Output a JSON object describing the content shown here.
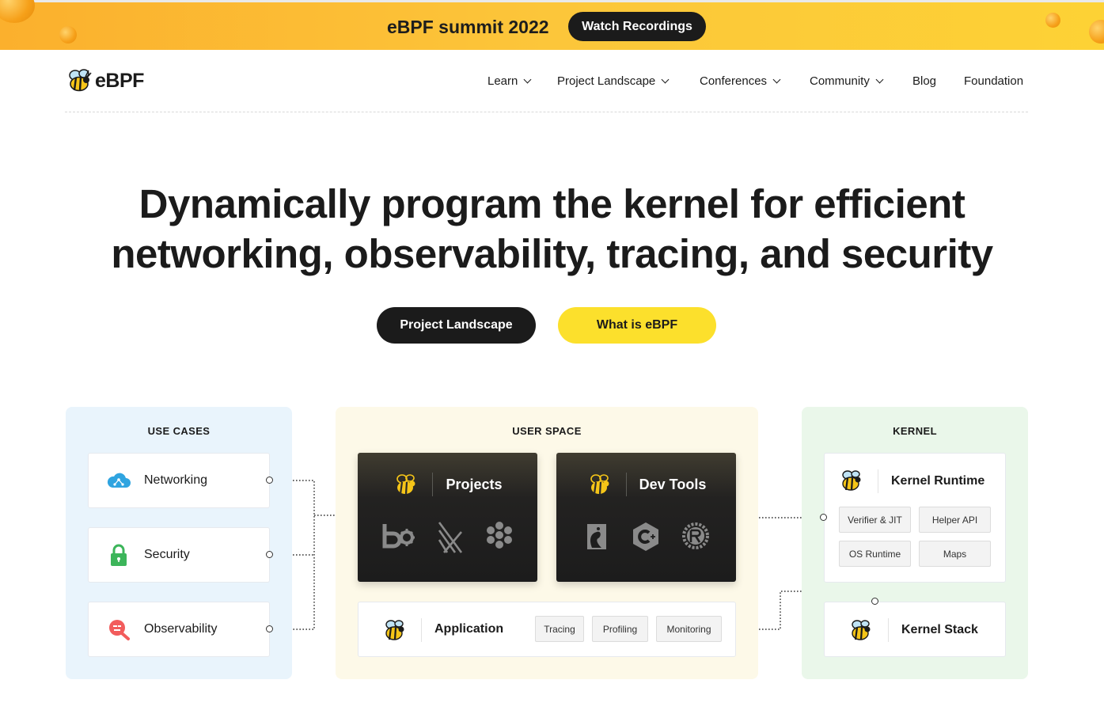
{
  "banner": {
    "title": "eBPF summit 2022",
    "button_label": "Watch Recordings",
    "background": "#fcc63a"
  },
  "header": {
    "logo_text": "eBPF",
    "nav": [
      {
        "label": "Learn",
        "dropdown": true
      },
      {
        "label": "Project Landscape",
        "dropdown": true
      },
      {
        "label": "Conferences",
        "dropdown": true
      },
      {
        "label": "Community",
        "dropdown": true
      },
      {
        "label": "Blog",
        "dropdown": false
      },
      {
        "label": "Foundation",
        "dropdown": false
      }
    ]
  },
  "hero": {
    "title_line1": "Dynamically program the kernel for efficient",
    "title_line2": "networking, observability, tracing, and security",
    "primary_button": "Project Landscape",
    "secondary_button": "What is eBPF",
    "primary_color": "#1b1b1b",
    "secondary_color": "#fce02c"
  },
  "diagram": {
    "use_cases": {
      "title": "USE CASES",
      "items": [
        {
          "label": "Networking",
          "icon": "cloud-network-icon"
        },
        {
          "label": "Security",
          "icon": "lock-icon"
        },
        {
          "label": "Observability",
          "icon": "magnifier-icon"
        }
      ]
    },
    "user_space": {
      "title": "USER SPACE",
      "projects": {
        "label": "Projects",
        "icons": [
          "bcc-icon",
          "bpftrace-icon",
          "cilium-icon"
        ]
      },
      "dev_tools": {
        "label": "Dev Tools",
        "icons": [
          "go-gopher-icon",
          "cpp-icon",
          "rust-icon"
        ]
      },
      "application": {
        "label": "Application",
        "tags": [
          "Tracing",
          "Profiling",
          "Monitoring"
        ]
      }
    },
    "kernel": {
      "title": "KERNEL",
      "runtime": {
        "label": "Kernel Runtime",
        "parts": [
          "Verifier & JIT",
          "Helper API",
          "OS Runtime",
          "Maps"
        ]
      },
      "stack": {
        "label": "Kernel Stack"
      }
    }
  }
}
